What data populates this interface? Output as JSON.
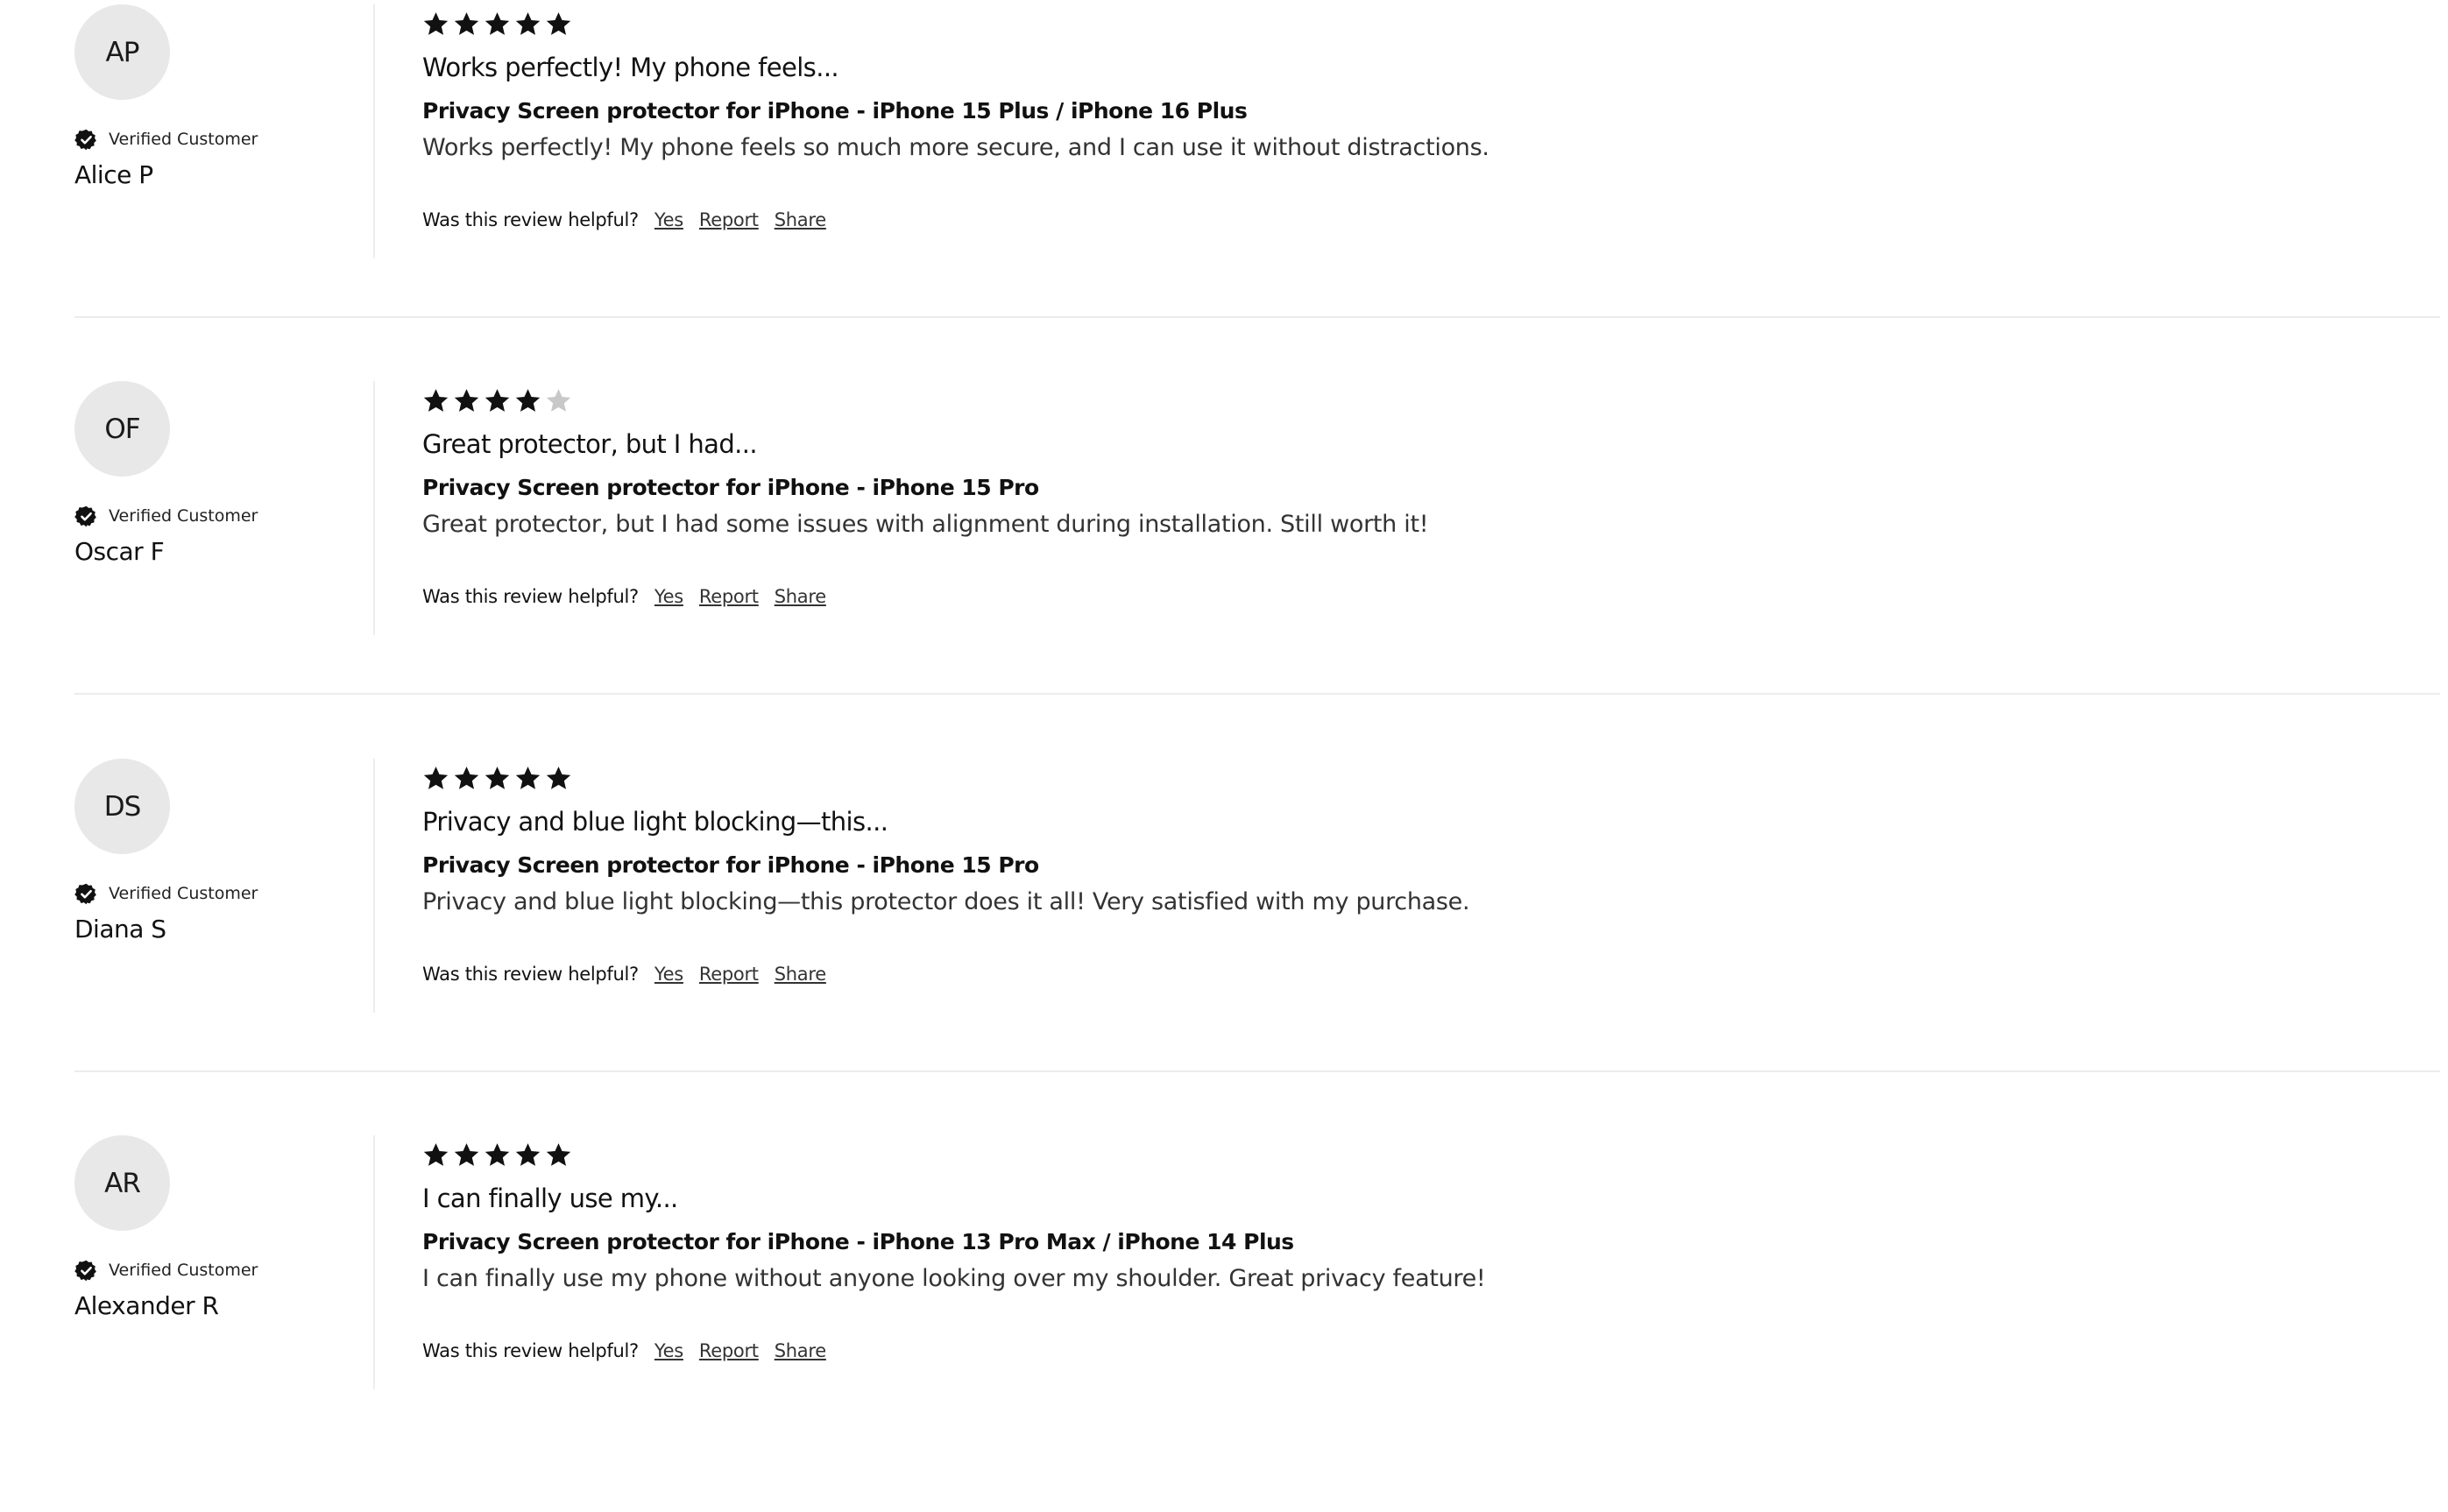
{
  "labels": {
    "verified": "Verified Customer",
    "helpful_question": "Was this review helpful?",
    "yes": "Yes",
    "report": "Report",
    "share": "Share"
  },
  "colors": {
    "star_filled": "#111111",
    "star_empty": "#c8c8c8",
    "avatar_bg": "#e8e8e8"
  },
  "reviews": [
    {
      "initials": "AP",
      "name": "Alice P",
      "rating": 5,
      "title": "Works perfectly! My phone feels...",
      "product": "Privacy Screen protector for iPhone - iPhone 15 Plus / iPhone 16 Plus",
      "body": "Works perfectly! My phone feels so much more secure, and I can use it without distractions."
    },
    {
      "initials": "OF",
      "name": "Oscar F",
      "rating": 4,
      "title": "Great protector, but I had...",
      "product": "Privacy Screen protector for iPhone - iPhone 15 Pro",
      "body": "Great protector, but I had some issues with alignment during installation. Still worth it!"
    },
    {
      "initials": "DS",
      "name": "Diana S",
      "rating": 5,
      "title": "Privacy and blue light blocking—this...",
      "product": "Privacy Screen protector for iPhone - iPhone 15 Pro",
      "body": "Privacy and blue light blocking—this protector does it all! Very satisfied with my purchase."
    },
    {
      "initials": "AR",
      "name": "Alexander R",
      "rating": 5,
      "title": "I can finally use my...",
      "product": "Privacy Screen protector for iPhone - iPhone 13 Pro Max / iPhone 14 Plus",
      "body": "I can finally use my phone without anyone looking over my shoulder. Great privacy feature!"
    }
  ]
}
